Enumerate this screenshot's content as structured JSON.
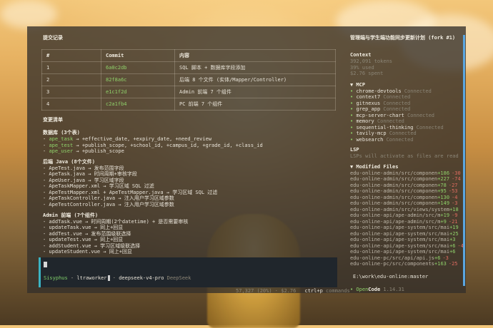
{
  "commits_panel": {
    "title": "提交记录",
    "columns": [
      "#",
      "Commit",
      "内容"
    ],
    "rows": [
      {
        "num": "1",
        "commit": "6a0c2db",
        "content": "SQL 脚本 + 数据库字段添加"
      },
      {
        "num": "2",
        "commit": "82f8a6c",
        "content": "后端 8 个文件 (实体/Mapper/Controller)"
      },
      {
        "num": "3",
        "commit": "e1c1f2d",
        "content": "Admin 前端 7 个组件"
      },
      {
        "num": "4",
        "commit": "c2a1fb4",
        "content": "PC 前端 7 个组件"
      }
    ]
  },
  "changes": {
    "title": "变更清单",
    "db": {
      "title": "数据库 (3个表)",
      "items": [
        {
          "name": "ape_task",
          "desc": "+effective_date, +expiry_date, +need_review"
        },
        {
          "name": "ape_test",
          "desc": "+publish_scope, +school_id, +campus_id, +grade_id, +class_id"
        },
        {
          "name": "ape_user",
          "desc": "+publish_scope"
        }
      ]
    },
    "backend": {
      "title": "后端 Java (8个文件)",
      "items": [
        "- ApeTest.java → 发布范围字段",
        "- ApeTask.java → 时间周期+审核字段",
        "- ApeUser.java → 学习区域字段",
        "- ApeTaskMapper.xml → 学习区域 SQL 过滤",
        "- ApeTestMapper.xml + ApeTestMapper.java → 学习区域 SQL 过滤",
        "- ApeTaskController.java → 注入用户学习区域参数",
        "- ApeTestController.java → 注入用户学习区域参数"
      ]
    },
    "admin": {
      "title": "Admin 前端 (7个组件)",
      "items": [
        "- addTask.vue → 时间周期(2个datetime) + 是否需要审核",
        "- updateTask.vue → 同上+回显",
        "- addTest.vue → 发布范围级联选择",
        "- updateTest.vue → 同上+回显",
        "- addStudent.vue → 学习区域级联选择",
        "- updateStudent.vue → 同上+回显"
      ]
    }
  },
  "terminal": {
    "agent": "Sisyphus",
    "separator1": " - ",
    "worker": "ltraworker",
    "separator2": " · ",
    "model": "deepseek-v4-pro",
    "provider": "DeepSeek",
    "status_tokens": "57,327 (20%)",
    "status_cost": "$2.76",
    "hint_key": "ctrl+p",
    "hint_label": "commands"
  },
  "sidebar": {
    "title": "管理端与学生端功能同步更新计划 (fork #1)",
    "context": {
      "title": "Context",
      "tokens": "392,091 tokens",
      "used": "39% used",
      "spent": "$2.76 spent"
    },
    "mcp": {
      "title": "▼ MCP",
      "items": [
        {
          "name": "chrome-devtools",
          "status": "Connected"
        },
        {
          "name": "context7",
          "status": "Connected"
        },
        {
          "name": "gitnexus",
          "status": "Connected"
        },
        {
          "name": "grep_app",
          "status": "Connected"
        },
        {
          "name": "mcp-server-chart",
          "status": "Connected"
        },
        {
          "name": "memory",
          "status": "Connected"
        },
        {
          "name": "sequential-thinking",
          "status": "Connected"
        },
        {
          "name": "tavily-mcp",
          "status": "Connected"
        },
        {
          "name": "websearch",
          "status": "Connected"
        }
      ]
    },
    "lsp": {
      "title": "LSP",
      "text": "LSPs will activate as files are read"
    },
    "modified": {
      "title": "▼ Modified Files",
      "files": [
        {
          "path": "edu-online-admin/src/componen",
          "add": "+186",
          "del": "-30"
        },
        {
          "path": "edu-online-admin/src/componen",
          "add": "+227",
          "del": "-74"
        },
        {
          "path": "edu-online-admin/src/componen",
          "add": "+78",
          "del": "-27"
        },
        {
          "path": "edu-online-admin/src/componen",
          "add": "+95",
          "del": "-53"
        },
        {
          "path": "edu-online-admin/src/componen",
          "add": "+130",
          "del": "-4"
        },
        {
          "path": "edu-online-admin/src/componen",
          "add": "+149",
          "del": "-3"
        },
        {
          "path": "edu-online-admin/src/views/system",
          "add": "+18",
          "del": ""
        },
        {
          "path": "edu-online-api/ape-admin/src/m",
          "add": "+19",
          "del": "-9"
        },
        {
          "path": "edu-online-api/ape-admin/src/m",
          "add": "+9",
          "del": "-21"
        },
        {
          "path": "edu-online-api/ape-system/src/mai",
          "add": "+19",
          "del": ""
        },
        {
          "path": "edu-online-api/ape-system/src/mai",
          "add": "+25",
          "del": ""
        },
        {
          "path": "edu-online-api/ape-system/src/mai",
          "add": "+3",
          "del": ""
        },
        {
          "path": "edu-online-api/ape-system/src/mai",
          "add": "+6",
          "del": "-4"
        },
        {
          "path": "edu-online-api/ape-system/src/mai",
          "add": "+6",
          "del": ""
        },
        {
          "path": "edu-online-pc/src/api/api.js",
          "add": "+6",
          "del": "-3"
        },
        {
          "path": "edu-online-pc/src/components",
          "add": "+163",
          "del": "-25"
        }
      ]
    },
    "cwd": "E:\\work\\edu-online:master",
    "app_name": "Code",
    "app_brand": "• Open",
    "version": "1.14.31"
  },
  "colors": {
    "accent_cyan": "#3bb3c3",
    "commit_green": "#8fd16a",
    "add_green": "#8fd16a",
    "del_red": "#e06c60",
    "scroll_blue": "#5aa6e0"
  }
}
